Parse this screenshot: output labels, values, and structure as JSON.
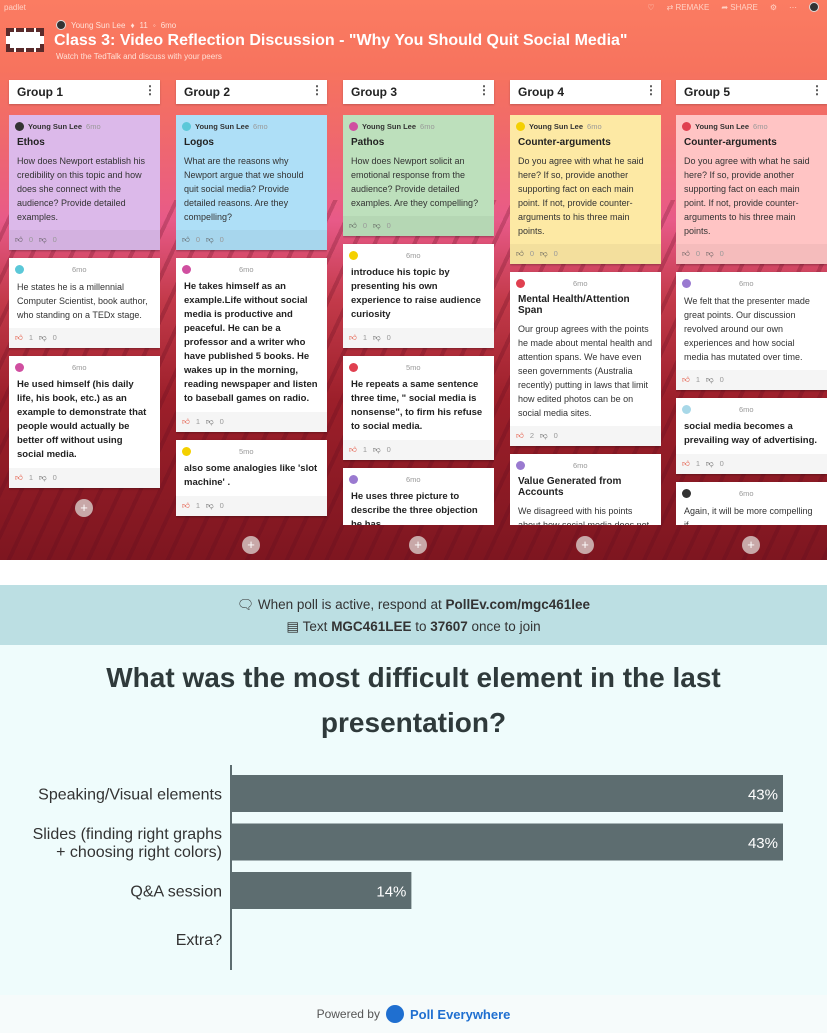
{
  "topbar": {
    "brand": "padlet",
    "remake": "REMAKE",
    "share": "SHARE"
  },
  "header": {
    "author": "Young Sun Lee",
    "likes": "11",
    "age": "6mo",
    "title": "Class 3: Video Reflection Discussion - \"Why You Should Quit Social Media\"",
    "subtitle": "Watch the TedTalk and discuss with your peers"
  },
  "columns": [
    {
      "title": "Group 1",
      "cards": [
        {
          "color": "purple",
          "author": "Young Sun Lee",
          "age": "6mo",
          "heading": "Ethos",
          "body": "How does Newport establish his credibility on this topic and how does she connect with the audience? Provide detailed examples.",
          "up": "0",
          "down": "0"
        },
        {
          "color": "white",
          "author": "",
          "age": "6mo",
          "body": "He states he is a millennial Computer Scientist, book author, who standing on a TEDx stage.",
          "up": "1",
          "down": "0"
        },
        {
          "color": "white",
          "author": "",
          "age": "6mo",
          "body": "He used himself (his daily life, his book, etc.) as an example to demonstrate that people would actually be better off without using social media.",
          "bold": true,
          "up": "1",
          "down": "0"
        }
      ]
    },
    {
      "title": "Group 2",
      "cards": [
        {
          "color": "blue",
          "author": "Young Sun Lee",
          "age": "6mo",
          "heading": "Logos",
          "body": "What are the reasons why Newport argue that we should quit social media? Provide detailed reasons. Are they compelling?",
          "up": "0",
          "down": "0"
        },
        {
          "color": "white",
          "author": "",
          "age": "6mo",
          "body": "He takes himself as an example.Life without social media is productive and peaceful. He can be a professor and a writer who have published 5 books. He wakes up in the morning, reading newspaper and listen to baseball games on radio.",
          "bold": true,
          "up": "1",
          "down": "0"
        },
        {
          "color": "white",
          "author": "",
          "age": "5mo",
          "body": "also some analogies like 'slot machine' .",
          "bold": true,
          "up": "1",
          "down": "0"
        }
      ]
    },
    {
      "title": "Group 3",
      "cards": [
        {
          "color": "green",
          "author": "Young Sun Lee",
          "age": "6mo",
          "heading": "Pathos",
          "body": "How does Newport solicit an emotional response from the audience? Provide detailed examples. Are they compelling?",
          "up": "0",
          "down": "0"
        },
        {
          "color": "white",
          "author": "",
          "age": "6mo",
          "body": "introduce his topic by presenting his own experience to raise audience curiosity",
          "bold": true,
          "up": "1",
          "down": "0"
        },
        {
          "color": "white",
          "author": "",
          "age": "5mo",
          "body": "He repeats a same sentence three time, \" social media is nonsense\", to firm his refuse to social media.",
          "bold": true,
          "up": "1",
          "down": "0"
        },
        {
          "color": "white",
          "author": "",
          "age": "6mo",
          "body": "He uses three picture to describe the three objection he has",
          "bold": true,
          "up": "",
          "down": ""
        }
      ]
    },
    {
      "title": "Group 4",
      "cards": [
        {
          "color": "yellow",
          "author": "Young Sun Lee",
          "age": "6mo",
          "heading": "Counter-arguments",
          "body": "Do you agree with what he said here? If so, provide another supporting fact on each main point. If not, provide counter-arguments to his three main points.",
          "up": "0",
          "down": "0"
        },
        {
          "color": "white",
          "author": "",
          "age": "6mo",
          "heading": "Mental Health/Attention Span",
          "body": "Our group agrees with the points he made about mental health and attention spans. We have even seen governments (Australia recently) putting in laws that limit how edited photos can be on social media sites.",
          "up": "2",
          "down": "0"
        },
        {
          "color": "white",
          "author": "",
          "age": "6mo",
          "heading": "Value Generated from Accounts",
          "body": "We disagreed with his points about how social media does not provide",
          "up": "",
          "down": ""
        }
      ]
    },
    {
      "title": "Group 5",
      "cards": [
        {
          "color": "pink",
          "author": "Young Sun Lee",
          "age": "6mo",
          "heading": "Counter-arguments",
          "body": "Do you agree with what he said here? If so, provide another supporting fact on each main point. If not, provide counter-arguments to his three main points.",
          "up": "0",
          "down": "0"
        },
        {
          "color": "white",
          "author": "",
          "age": "6mo",
          "body": "We felt that the presenter made great points. Our discussion revolved around our own experiences and how social media has mutated over time.",
          "up": "1",
          "down": "0"
        },
        {
          "color": "white",
          "author": "",
          "age": "6mo",
          "body": "social media becomes a prevailing way of advertising.",
          "bold": true,
          "up": "1",
          "down": "0"
        },
        {
          "color": "white",
          "author": "",
          "age": "6mo",
          "body": "Again, it will be more compelling if",
          "up": "",
          "down": ""
        }
      ]
    }
  ],
  "poll": {
    "respond_prefix": "When poll is active, respond at ",
    "respond_url": "PollEv.com/mgc461lee",
    "text_prefix": "Text ",
    "text_code": "MGC461LEE",
    "text_mid": " to ",
    "text_number": "37607",
    "text_suffix": " once to join",
    "question": "What was the most difficult element in the last presentation?",
    "powered_by": "Powered by",
    "brand": "Poll Everywhere"
  },
  "chart_data": {
    "type": "bar",
    "orientation": "horizontal",
    "categories": [
      "Speaking/Visual elements",
      "Slides (finding right graphs + choosing right colors)",
      "Q&A session",
      "Extra?"
    ],
    "values": [
      43,
      43,
      14,
      0
    ],
    "value_labels": [
      "43%",
      "43%",
      "14%",
      ""
    ],
    "unit": "%",
    "xlim": [
      0,
      43
    ],
    "bar_color": "#5d6d70",
    "grid": false
  }
}
